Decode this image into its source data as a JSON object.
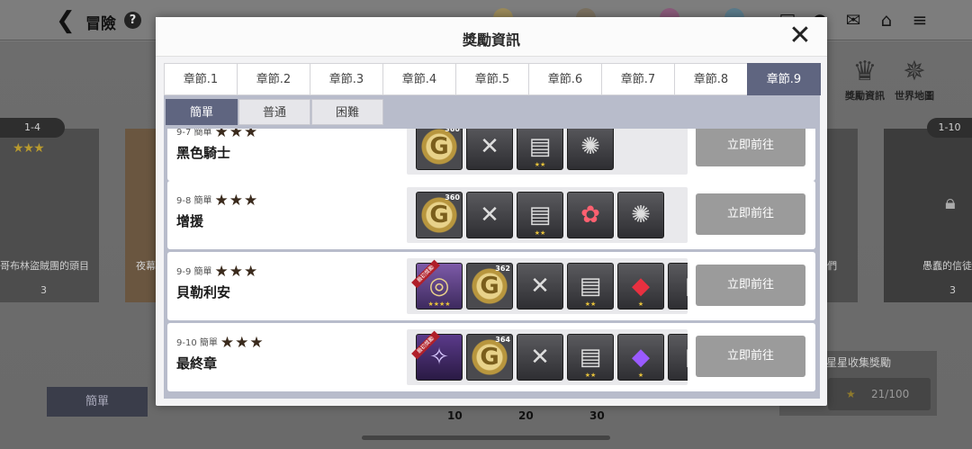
{
  "topbar": {
    "title": "冒險",
    "help_glyph": "?",
    "back_glyph": "❮",
    "icons": [
      "phone-icon",
      "chat-icon",
      "mail-icon",
      "home-icon",
      "menu-icon"
    ],
    "icon_glyphs": [
      "▣",
      "●",
      "✉",
      "⌂",
      "≡"
    ]
  },
  "background": {
    "left_card": {
      "tag": "1-4",
      "label": "哥布林盜賊團的頭目",
      "count": "3"
    },
    "left_card2": {
      "label": "夜幕"
    },
    "right_card": {
      "tag": "1-10",
      "label": "愚蠢的信徒",
      "count": "3"
    },
    "mid_label": "們",
    "difficulty_button": "簡單",
    "reward_info": "獎勵資訊",
    "world_map": "世界地圖",
    "progress_marks": [
      "10",
      "20",
      "30"
    ],
    "star_collection": {
      "title": "星星收集獎勵",
      "value": "21/100"
    }
  },
  "dialog": {
    "title": "獎勵資訊",
    "close_glyph": "✕",
    "chapter_tabs": [
      "章節.1",
      "章節.2",
      "章節.3",
      "章節.4",
      "章節.5",
      "章節.6",
      "章節.7",
      "章節.8",
      "章節.9"
    ],
    "active_chapter": 8,
    "difficulty_tabs": [
      "簡單",
      "普通",
      "困難"
    ],
    "active_difficulty": 0,
    "stages": [
      {
        "id": "9-7",
        "difficulty": "簡單",
        "stars": "★★★",
        "name": "黑色騎士",
        "button": "立即前往",
        "items": [
          {
            "type": "gold-coin",
            "glyph": "G",
            "count": "360"
          },
          {
            "type": "sword-shards",
            "glyph": "✕"
          },
          {
            "type": "treasure-chest",
            "glyph": "▤",
            "stars": "★★"
          },
          {
            "type": "dark-emblem",
            "glyph": "✺"
          }
        ]
      },
      {
        "id": "9-8",
        "difficulty": "簡單",
        "stars": "★★★",
        "name": "增援",
        "button": "立即前往",
        "items": [
          {
            "type": "gold-coin",
            "glyph": "G",
            "count": "360"
          },
          {
            "type": "sword-shards",
            "glyph": "✕"
          },
          {
            "type": "treasure-chest",
            "glyph": "▤",
            "stars": "★★"
          },
          {
            "type": "red-flower-gem",
            "glyph": "✿"
          },
          {
            "type": "dark-emblem",
            "glyph": "✺"
          }
        ]
      },
      {
        "id": "9-9",
        "difficulty": "簡單",
        "stars": "★★★",
        "name": "貝勒利安",
        "button": "立即前往",
        "items": [
          {
            "type": "ring",
            "glyph": "◎",
            "ribbon": "最初獎勵",
            "stars": "★★★★"
          },
          {
            "type": "gold-coin",
            "glyph": "G",
            "count": "362"
          },
          {
            "type": "sword-shards",
            "glyph": "✕"
          },
          {
            "type": "treasure-chest",
            "glyph": "▤",
            "stars": "★★"
          },
          {
            "type": "red-gem",
            "glyph": "◆",
            "stars": "★"
          },
          {
            "type": "partial-item",
            "glyph": "▯"
          }
        ]
      },
      {
        "id": "9-10",
        "difficulty": "簡單",
        "stars": "★★★",
        "name": "最終章",
        "button": "立即前往",
        "items": [
          {
            "type": "purple-wings",
            "glyph": "✧",
            "ribbon": "最初獎勵"
          },
          {
            "type": "gold-coin",
            "glyph": "G",
            "count": "364"
          },
          {
            "type": "sword-shards",
            "glyph": "✕"
          },
          {
            "type": "treasure-chest",
            "glyph": "▤",
            "stars": "★★"
          },
          {
            "type": "purple-gem",
            "glyph": "◆",
            "stars": "★"
          },
          {
            "type": "partial-item",
            "glyph": "▯"
          }
        ]
      }
    ]
  },
  "colors": {
    "active_tab": "#5f6580",
    "go_button": "#9b9b9b",
    "panel_bg": "#b8bccb",
    "star": "#3a2a1c"
  }
}
